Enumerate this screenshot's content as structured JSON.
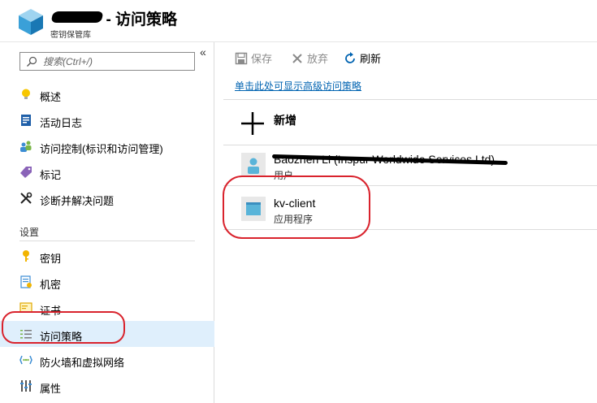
{
  "header": {
    "title": "- 访问策略",
    "subtitle": "密钥保管库"
  },
  "sidebar": {
    "search": {
      "placeholder": "搜索(Ctrl+/)",
      "value": ""
    },
    "collapse_label": "«",
    "items": [
      {
        "label": "概述",
        "icon": "lightbulb-icon"
      },
      {
        "label": "活动日志",
        "icon": "activity-log-icon"
      },
      {
        "label": "访问控制(标识和访问管理)",
        "icon": "users-icon"
      },
      {
        "label": "标记",
        "icon": "tag-icon"
      },
      {
        "label": "诊断并解决问题",
        "icon": "wrench-icon"
      }
    ],
    "settings_label": "设置",
    "settings_items": [
      {
        "label": "密钥",
        "icon": "key-icon"
      },
      {
        "label": "机密",
        "icon": "secret-icon"
      },
      {
        "label": "证书",
        "icon": "certificate-icon"
      },
      {
        "label": "访问策略",
        "icon": "policy-list-icon",
        "selected": true
      },
      {
        "label": "防火墙和虚拟网络",
        "icon": "network-icon"
      },
      {
        "label": "属性",
        "icon": "properties-icon"
      }
    ]
  },
  "toolbar": {
    "save_label": "保存",
    "discard_label": "放弃",
    "refresh_label": "刷新"
  },
  "main": {
    "advanced_link": "单击此处可显示高级访问策略",
    "add_label": "新增",
    "entries": [
      {
        "name": "Baozhen Li (Inspur Worldwide Services Ltd)",
        "type": "用户",
        "icon": "user-icon",
        "redacted": true
      },
      {
        "name": "kv-client",
        "type": "应用程序",
        "icon": "application-icon",
        "redacted": false
      }
    ]
  },
  "colors": {
    "link": "#0063b1",
    "selected_bg": "#dfeffc",
    "annotation_red": "#d9232d",
    "refresh_blue": "#0063b1"
  }
}
